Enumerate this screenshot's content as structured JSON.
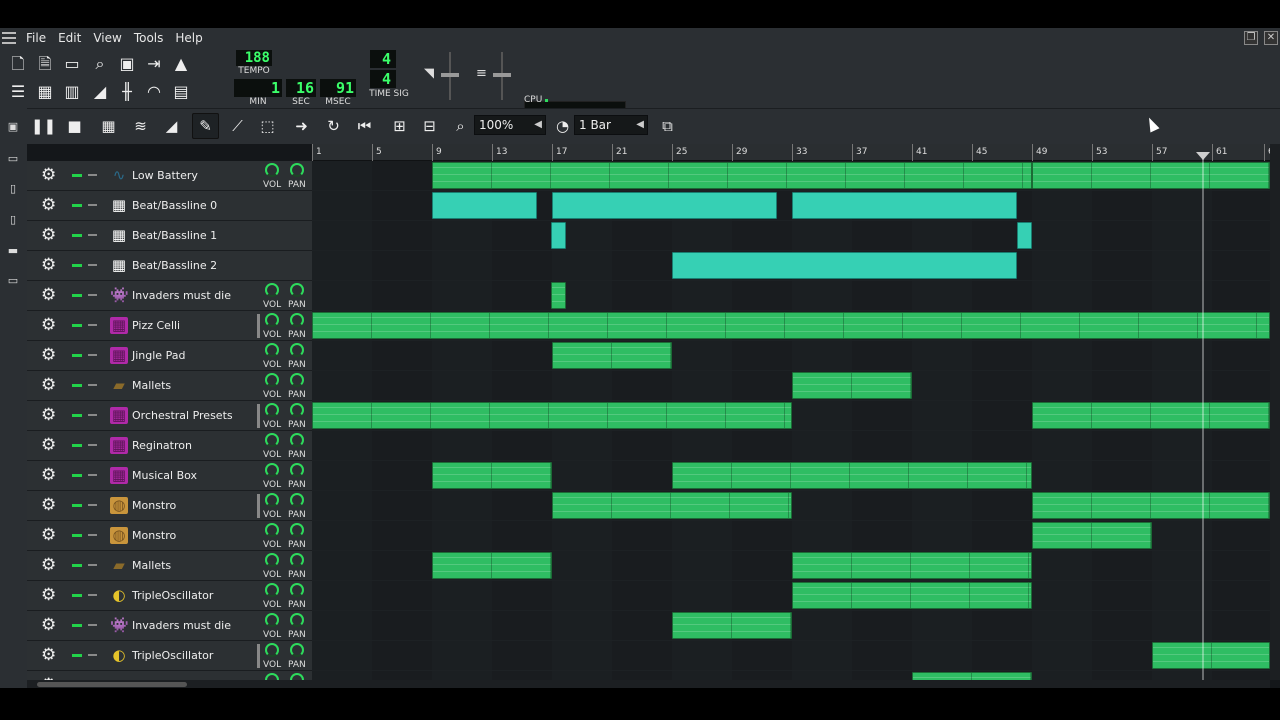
{
  "menu": [
    "File",
    "Edit",
    "View",
    "Tools",
    "Help"
  ],
  "window_buttons": [
    "restore-icon",
    "close-icon"
  ],
  "toolbar": {
    "tempo": "188",
    "tempo_label": "TEMPO",
    "min": "1",
    "min_label": "MIN",
    "sec": "16",
    "sec_label": "SEC",
    "msec": "91",
    "msec_label": "MSEC",
    "timesig_top": "4",
    "timesig_bottom": "4",
    "timesig_label": "TIME SIG",
    "cpu_label": "CPU"
  },
  "edit_toolbar": {
    "zoom": "100%",
    "quantize": "1 Bar"
  },
  "ruler": [
    "1",
    "5",
    "9",
    "13",
    "17",
    "21",
    "25",
    "29",
    "33",
    "37",
    "41",
    "45",
    "49",
    "53",
    "57",
    "61",
    "6"
  ],
  "tracks": [
    {
      "name": "Low Battery",
      "icon": "waveform-icon",
      "icon_color": "#2a6a8a",
      "knobs": true,
      "clips": [
        {
          "s": 9,
          "e": 49,
          "t": "g"
        },
        {
          "s": 49,
          "e": 65,
          "t": "g"
        }
      ]
    },
    {
      "name": "Beat/Bassline 0",
      "icon": "grid-icon",
      "icon_color": "#ffffff",
      "knobs": false,
      "clips": [
        {
          "s": 9,
          "e": 16,
          "t": "c"
        },
        {
          "s": 17,
          "e": 32,
          "t": "c"
        },
        {
          "s": 33,
          "e": 48,
          "t": "c"
        }
      ]
    },
    {
      "name": "Beat/Bassline 1",
      "icon": "grid-icon",
      "icon_color": "#ffffff",
      "knobs": false,
      "clips": [
        {
          "s": 16.9,
          "e": 17.9,
          "t": "c"
        },
        {
          "s": 48,
          "e": 49,
          "t": "c"
        }
      ]
    },
    {
      "name": "Beat/Bassline 2",
      "icon": "grid-icon",
      "icon_color": "#ffffff",
      "knobs": false,
      "clips": [
        {
          "s": 25,
          "e": 48,
          "t": "c"
        }
      ]
    },
    {
      "name": "Invaders must die",
      "icon": "invader-icon",
      "icon_color": "#dddddd",
      "knobs": true,
      "clips": [
        {
          "s": 16.9,
          "e": 17.9,
          "t": "g"
        }
      ]
    },
    {
      "name": "Pizz Celli",
      "icon": "soundfont-icon",
      "icon_color": "#b02aa8",
      "knobs": true,
      "bar": true,
      "clips": [
        {
          "s": 1,
          "e": 65,
          "t": "g"
        }
      ]
    },
    {
      "name": "Jingle Pad",
      "icon": "soundfont-icon",
      "icon_color": "#b02aa8",
      "knobs": true,
      "clips": [
        {
          "s": 17,
          "e": 25,
          "t": "g"
        }
      ]
    },
    {
      "name": "Mallets",
      "icon": "mallets-icon",
      "icon_color": "#8a6a2a",
      "knobs": true,
      "clips": [
        {
          "s": 33,
          "e": 41,
          "t": "g"
        }
      ]
    },
    {
      "name": "Orchestral Presets",
      "icon": "soundfont-icon",
      "icon_color": "#b02aa8",
      "knobs": true,
      "bar": true,
      "clips": [
        {
          "s": 1,
          "e": 33,
          "t": "g"
        },
        {
          "s": 49,
          "e": 65,
          "t": "g"
        }
      ]
    },
    {
      "name": "Reginatron",
      "icon": "soundfont-icon",
      "icon_color": "#b02aa8",
      "knobs": true,
      "clips": []
    },
    {
      "name": "Musical Box",
      "icon": "soundfont-icon",
      "icon_color": "#b02aa8",
      "knobs": true,
      "clips": [
        {
          "s": 9,
          "e": 17,
          "t": "g"
        },
        {
          "s": 25,
          "e": 49,
          "t": "g"
        }
      ]
    },
    {
      "name": "Monstro",
      "icon": "monstro-icon",
      "icon_color": "#c9953c",
      "knobs": true,
      "bar": true,
      "clips": [
        {
          "s": 17,
          "e": 33,
          "t": "g"
        },
        {
          "s": 49,
          "e": 65,
          "t": "g"
        }
      ]
    },
    {
      "name": "Monstro",
      "icon": "monstro-icon",
      "icon_color": "#c9953c",
      "knobs": true,
      "clips": [
        {
          "s": 49,
          "e": 57,
          "t": "g"
        }
      ]
    },
    {
      "name": "Mallets",
      "icon": "mallets-icon",
      "icon_color": "#8a6a2a",
      "knobs": true,
      "clips": [
        {
          "s": 9,
          "e": 17,
          "t": "g"
        },
        {
          "s": 33,
          "e": 49,
          "t": "g"
        }
      ]
    },
    {
      "name": "TripleOscillator",
      "icon": "tripleosc-icon",
      "icon_color": "#e6c42a",
      "knobs": true,
      "clips": [
        {
          "s": 33,
          "e": 49,
          "t": "g"
        }
      ]
    },
    {
      "name": "Invaders must die",
      "icon": "invader-icon",
      "icon_color": "#dddddd",
      "knobs": true,
      "clips": [
        {
          "s": 25,
          "e": 33,
          "t": "g"
        }
      ]
    },
    {
      "name": "TripleOscillator",
      "icon": "tripleosc-icon",
      "icon_color": "#e6c42a",
      "knobs": true,
      "bar": true,
      "clips": [
        {
          "s": 57,
          "e": 65,
          "t": "g"
        }
      ]
    },
    {
      "name": "",
      "icon": "tripleosc-icon",
      "icon_color": "#e6c42a",
      "knobs": true,
      "clips": [
        {
          "s": 41,
          "e": 49,
          "t": "g"
        }
      ]
    }
  ],
  "knob_labels": {
    "vol": "VOL",
    "pan": "PAN"
  },
  "colors": {
    "clip_green": "#2fbd63",
    "clip_cyan": "#36d0b4",
    "lcd": "#3bff6a"
  }
}
